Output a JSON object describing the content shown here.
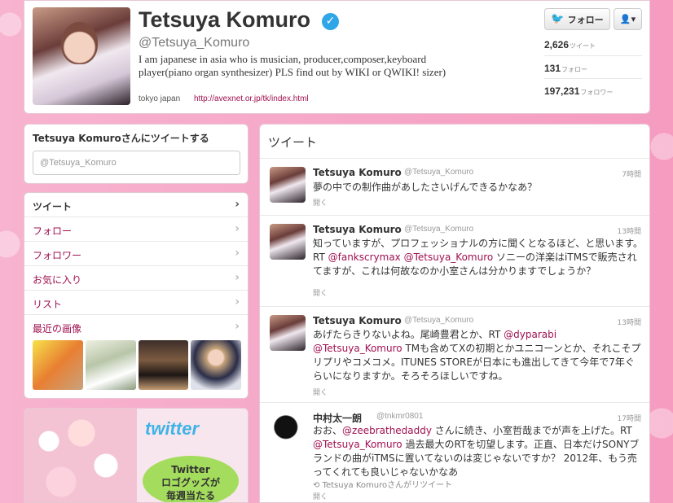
{
  "profile": {
    "name": "Tetsuya Komuro",
    "handle": "@Tetsuya_Komuro",
    "bio": "I am japanese in asia who is musician, producer,composer,keyboard player(piano organ synthesizer) PLS find out by WIKI or QWIKI! sizer)",
    "location": "tokyo japan",
    "url": "http://avexnet.or.jp/tk/index.html",
    "verified_glyph": "✓",
    "follow_label": "フォロー",
    "user_menu_glyph": "👤▾",
    "stats": [
      {
        "value": "2,626",
        "label": "ツイート"
      },
      {
        "value": "131",
        "label": "フォロー"
      },
      {
        "value": "197,231",
        "label": "フォロワー"
      }
    ]
  },
  "tweetbox": {
    "title": "Tetsuya Komuroさんにツイートする",
    "placeholder": "@Tetsuya_Komuro"
  },
  "nav": {
    "items": [
      {
        "label": "ツイート"
      },
      {
        "label": "フォロー"
      },
      {
        "label": "フォロワー"
      },
      {
        "label": "お気に入り"
      },
      {
        "label": "リスト"
      },
      {
        "label": "最近の画像"
      }
    ]
  },
  "ad": {
    "logo": "twitter",
    "line1": "Twitter",
    "line2": "ロゴグッズが",
    "line3": "毎週当たる"
  },
  "timeline": {
    "title": "ツイート",
    "open_label": "開く",
    "tweets": [
      {
        "name": "Tetsuya Komuro",
        "handle": "@Tetsuya_Komuro",
        "time": "7時間",
        "text": "夢の中での制作曲があしたさいげんできるかなあ？"
      },
      {
        "name": "Tetsuya Komuro",
        "handle": "@Tetsuya_Komuro",
        "time": "13時間",
        "text_a": "知っていますが、プロフェッショナルの方に聞くとなるほど、と思います。RT ",
        "mention1": "@fankscrymax",
        "text_b": " ",
        "mention2": "@Tetsuya_Komuro",
        "text_c": " ソニーの洋楽はiTMSで販売されてますが、これは何故なのか小室さんは分かりますでしょうか？"
      },
      {
        "name": "Tetsuya Komuro",
        "handle": "@Tetsuya_Komuro",
        "time": "13時間",
        "text_a": "あげたらきりないよね。尾崎豊君とか、RT ",
        "mention1": "@dyparabi",
        "text_b": " ",
        "mention2": "@Tetsuya_Komuro",
        "text_c": " TMも含めてXの初期とかユニコーンとか、それこそプリプリやコメコメ。ITUNES STOREが日本にも進出してきて今年で7年ぐらいになりますか。そろそろほしいですね。"
      },
      {
        "name": "中村太一朗",
        "handle": "@tnkmr0801",
        "time": "17時間",
        "text_a": "おお、",
        "mention1": "@zeebrathedaddy",
        "text_b": " さんに続き、小室哲哉までが声を上げた。RT ",
        "mention2": "@Tetsuya_Komuro",
        "text_c": " 過去最大のRTを切望します。正直、日本だけSONYブランドの曲がiTMSに置いてないのは変じゃないですか？ 2012年、もう売ってくれても良いじゃないかなあ",
        "retweet_note": "Tetsuya Komuroさんがリツイート"
      }
    ]
  }
}
